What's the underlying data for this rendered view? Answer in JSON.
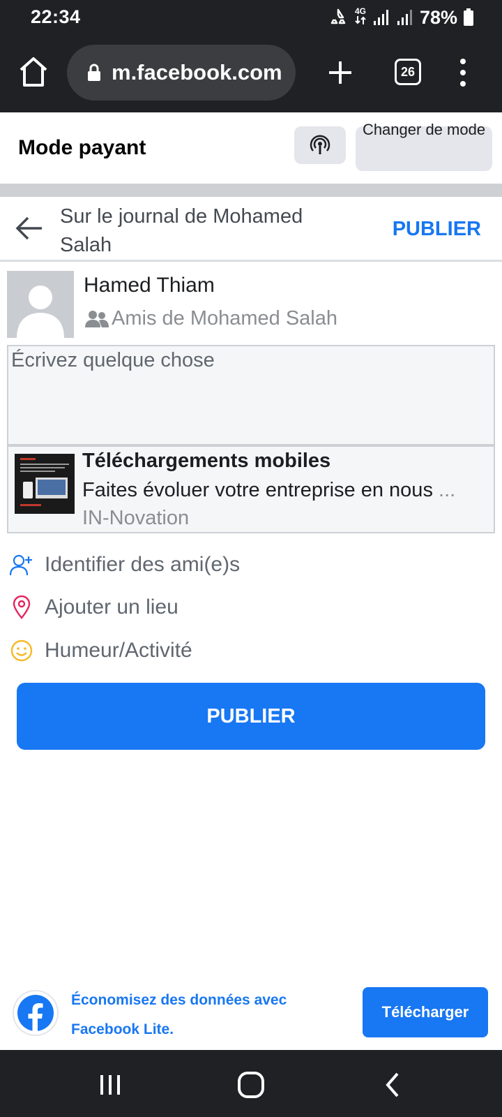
{
  "status_bar": {
    "time": "22:34",
    "network": "4G",
    "battery": "78%"
  },
  "browser": {
    "url": "m.facebook.com",
    "tab_count": "26"
  },
  "mode_bar": {
    "title": "Mode payant",
    "switch_label": "Changer de mode"
  },
  "composer": {
    "title": "Sur le journal de Mohamed Salah",
    "publish_label": "PUBLIER",
    "user_name": "Hamed Thiam",
    "audience": "Amis de Mohamed Salah",
    "placeholder": "Écrivez quelque chose"
  },
  "link_preview": {
    "title": "Téléchargements mobiles",
    "description": "Faites évoluer votre entreprise en nous",
    "ellipsis": "...",
    "domain": "IN-Novation"
  },
  "actions": [
    {
      "label": "Identifier des ami(e)s",
      "icon": "tag-friends-icon"
    },
    {
      "label": "Ajouter un lieu",
      "icon": "location-pin-icon"
    },
    {
      "label": "Humeur/Activité",
      "icon": "smiley-icon"
    }
  ],
  "publish_button_label": "PUBLIER",
  "promo": {
    "text": "Économisez des données avec Facebook Lite.",
    "button_label": "Télécharger"
  },
  "colors": {
    "accent": "#1877f2",
    "dark_bar": "#202124",
    "pin": "#e4245e",
    "smiley": "#f7b928"
  }
}
